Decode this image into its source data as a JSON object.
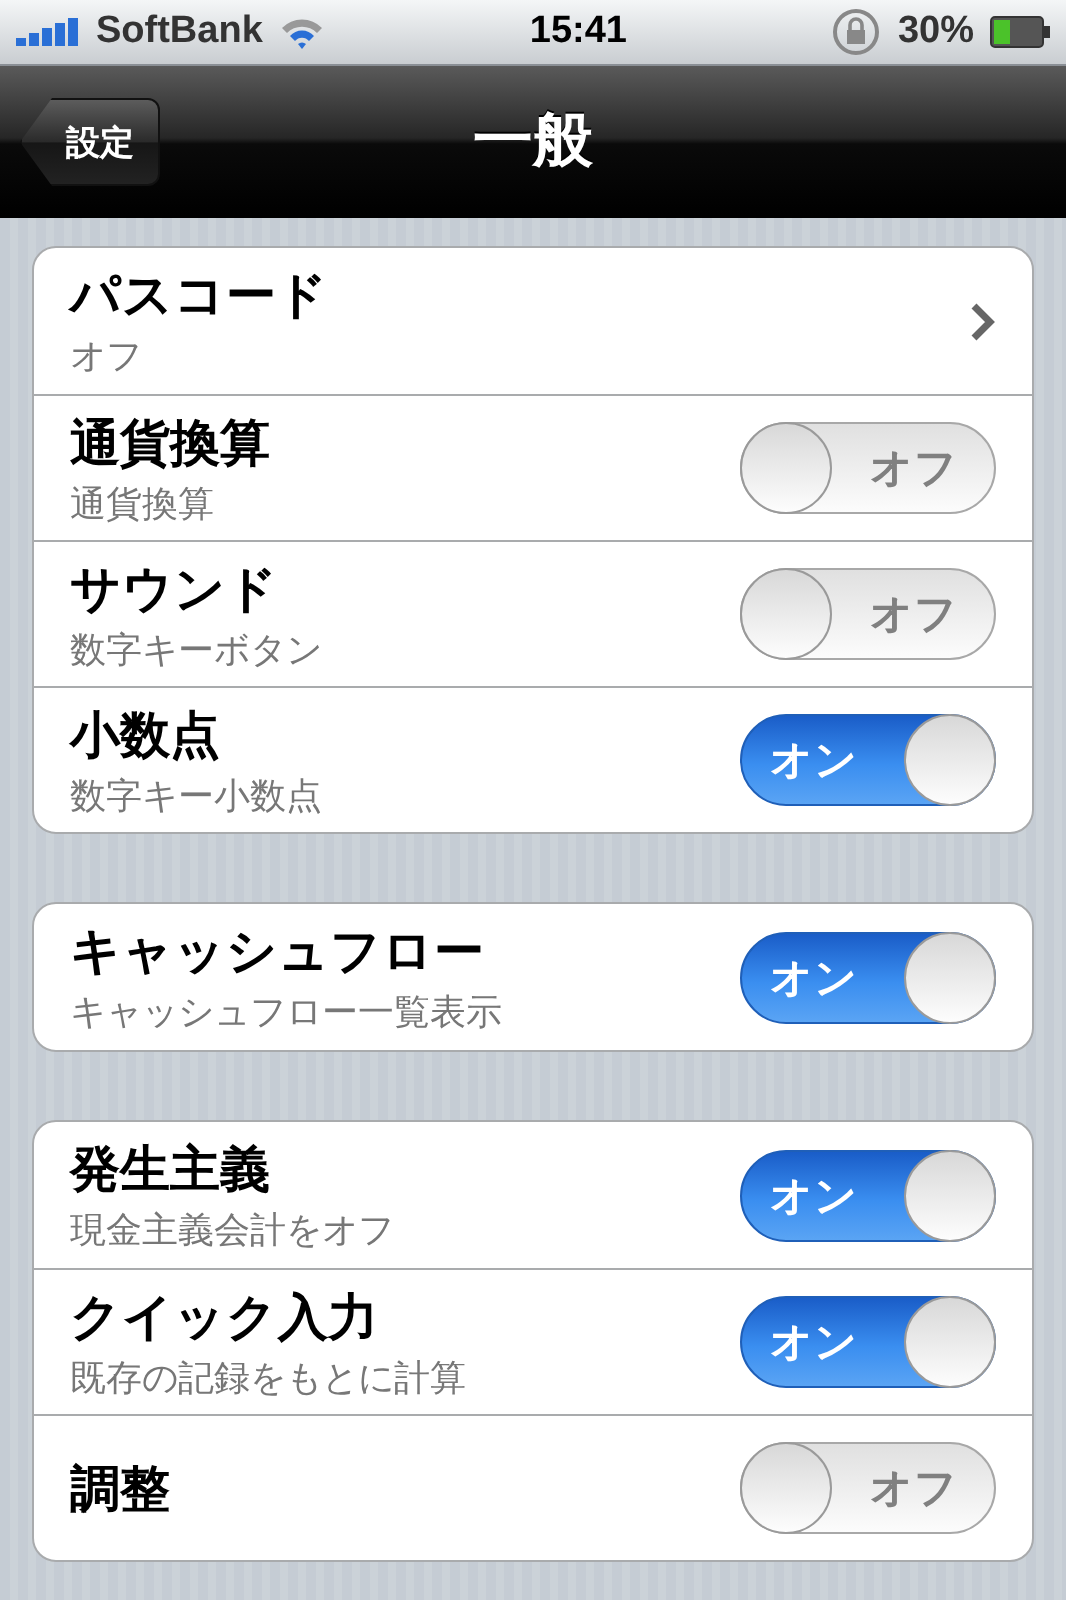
{
  "status_bar": {
    "carrier": "SoftBank",
    "time": "15:41",
    "battery": "30%"
  },
  "nav_bar": {
    "back": "設定",
    "title": "一般"
  },
  "groups": [
    {
      "rows": [
        {
          "kind": "disclosure",
          "title": "パスコード",
          "subtitle": "オフ"
        },
        {
          "kind": "switch",
          "title": "通貨換算",
          "subtitle": "通貨換算",
          "on": false,
          "switch_label": "オフ"
        },
        {
          "kind": "switch",
          "title": "サウンド",
          "subtitle": "数字キーボタン",
          "on": false,
          "switch_label": "オフ"
        },
        {
          "kind": "switch",
          "title": "小数点",
          "subtitle": "数字キー小数点",
          "on": true,
          "switch_label": "オン"
        }
      ]
    },
    {
      "rows": [
        {
          "kind": "switch",
          "title": "キャッシュフロー",
          "subtitle": "キャッシュフロー一覧表示",
          "on": true,
          "switch_label": "オン"
        }
      ]
    },
    {
      "rows": [
        {
          "kind": "switch",
          "title": "発生主義",
          "subtitle": "現金主義会計をオフ",
          "on": true,
          "switch_label": "オン"
        },
        {
          "kind": "switch",
          "title": "クイック入力",
          "subtitle": "既存の記録をもとに計算",
          "on": true,
          "switch_label": "オン"
        },
        {
          "kind": "switch",
          "title": "調整",
          "on": false,
          "switch_label": "オフ"
        }
      ]
    }
  ]
}
